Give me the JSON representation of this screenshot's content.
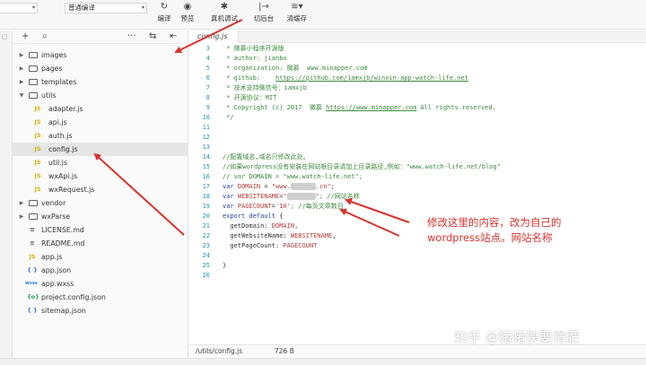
{
  "toolbar": {
    "compile_mode": "普通编译",
    "buttons": [
      {
        "label": "编译",
        "icon": "compile-icon"
      },
      {
        "label": "预览",
        "icon": "preview-icon"
      },
      {
        "label": "真机调试",
        "icon": "debug-icon"
      },
      {
        "label": "切后台",
        "icon": "background-icon"
      },
      {
        "label": "清缓存",
        "icon": "clear-cache-icon"
      }
    ]
  },
  "explorer": {
    "items": [
      {
        "name": "images",
        "type": "folder",
        "expanded": false
      },
      {
        "name": "pages",
        "type": "folder",
        "expanded": false
      },
      {
        "name": "templates",
        "type": "folder",
        "expanded": false
      },
      {
        "name": "utils",
        "type": "folder",
        "expanded": true
      },
      {
        "name": "adapter.js",
        "type": "js",
        "badge": "JS"
      },
      {
        "name": "api.js",
        "type": "js",
        "badge": "JS"
      },
      {
        "name": "auth.js",
        "type": "js",
        "badge": "JS"
      },
      {
        "name": "config.js",
        "type": "js",
        "badge": "JS",
        "selected": true
      },
      {
        "name": "util.js",
        "type": "js",
        "badge": "JS"
      },
      {
        "name": "wxApi.js",
        "type": "js",
        "badge": "JS"
      },
      {
        "name": "wxRequest.js",
        "type": "js",
        "badge": "JS"
      },
      {
        "name": "vendor",
        "type": "folder",
        "expanded": false
      },
      {
        "name": "wxParse",
        "type": "folder",
        "expanded": false
      },
      {
        "name": "LICENSE.md",
        "type": "md",
        "badge": "≡"
      },
      {
        "name": "README.md",
        "type": "md",
        "badge": "≡"
      },
      {
        "name": "app.js",
        "type": "js",
        "badge": "JS"
      },
      {
        "name": "app.json",
        "type": "json",
        "badge": "{ }"
      },
      {
        "name": "app.wxss",
        "type": "wxss",
        "badge": "wxss"
      },
      {
        "name": "project.config.json",
        "type": "json",
        "badge": "{o}"
      },
      {
        "name": "sitemap.json",
        "type": "json",
        "badge": "{ }"
      }
    ]
  },
  "editor": {
    "tab": "config.js",
    "line_numbers": [
      "3",
      "4",
      "5",
      "6",
      "7",
      "8",
      "9",
      "10",
      "11",
      "12",
      "13",
      "14",
      "15",
      "16",
      "17",
      "18",
      "19",
      "20",
      "21",
      "22",
      "23",
      "24",
      "25",
      "26"
    ],
    "lines": {
      "l3": " * 微慕小程序开源版",
      "l4": " * author: jianbo",
      "l5_a": " * organization: 微慕  ",
      "l5_b": "www.minapper.com",
      "l6_a": " * github:    ",
      "l6_b": "https://github.com/iamxjb/winxin-app-watch-life.net",
      "l7": " * 技术支持微信号：iamxjb",
      "l8": " * 开源协议：MIT",
      "l9_a": " * Copyright (c) 2017  微慕 ",
      "l9_b": "https://www.minapper.com",
      "l9_c": " All rights reserved.",
      "l10": " */",
      "l14": "//配置域名,域名只修改此处。",
      "l15": "//如果wordpress没有安装在网站根目录请加上目录路径,例如：\"www.watch-life.net/blog\"",
      "l16": "// var DOMAIN = \"www.watch-life.net\";",
      "l17_a": "var ",
      "l17_b": "DOMAIN",
      "l17_c": " = ",
      "l17_d": "\"www.",
      "l17_e": ".cn\"",
      "l17_f": ";",
      "l18_a": "var ",
      "l18_b": "WEBSITENAME",
      "l18_c": "=",
      "l18_d": "\"",
      "l18_e": "\"",
      "l18_f": "; //网站名称",
      "l19_a": "var ",
      "l19_b": "PAGECOUNT",
      "l19_c": "=",
      "l19_d": "'10'",
      "l19_e": "; //每页文章数目",
      "l20_a": "export default ",
      "l20_b": "{",
      "l21_a": "  getDomain: ",
      "l21_b": "DOMAIN",
      "l21_c": ",",
      "l22_a": "  getWebsiteName: ",
      "l22_b": "WEBSITENAME",
      "l22_c": ",",
      "l23_a": "  getPageCount: ",
      "l23_b": "PAGECOUNT",
      "l25": "}"
    }
  },
  "status": {
    "path": "/utils/config.js",
    "size": "726 B"
  },
  "annotation": {
    "line1": "修改这里的内容，改为自己的",
    "line2": "wordpress站点。网站名称",
    "color": "#d8332e"
  },
  "watermark": "知乎 @猪猪侠要增肥"
}
